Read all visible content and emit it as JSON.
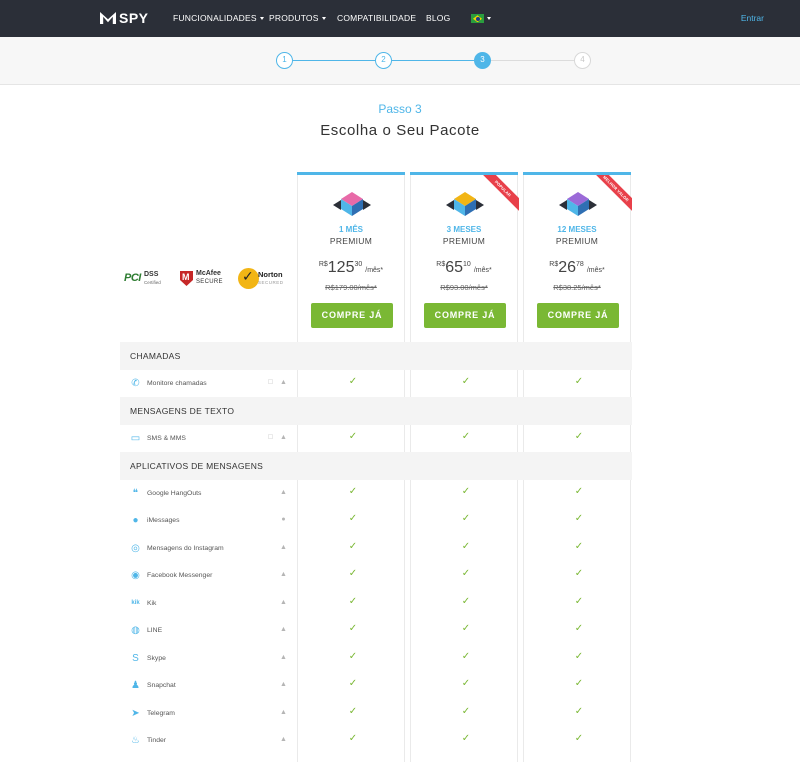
{
  "nav": {
    "logo_text": "SPY",
    "items": [
      "FUNCIONALIDADES",
      "PRODUTOS",
      "COMPATIBILIDADE",
      "BLOG"
    ],
    "login": "Entrar"
  },
  "steps": [
    "1",
    "2",
    "3",
    "4"
  ],
  "active_step": 3,
  "heading": {
    "step": "Passo 3",
    "title": "Escolha o Seu Pacote"
  },
  "badges": {
    "pci": "DSS",
    "pci_sub": "Certified",
    "mcafee": "McAfee",
    "mcafee_sub": "SECURE",
    "norton": "Norton",
    "norton_sub": "SECURED"
  },
  "plans": [
    {
      "months": "1 MÊS",
      "name": "PREMIUM",
      "currency": "R$",
      "int": "125",
      "cents": "30",
      "per": "/mês*",
      "old": "R$179.00/mês*",
      "button": "COMPRE JÁ",
      "ribbon": "",
      "colors": [
        "#e86aa8",
        "#4fb6e8"
      ]
    },
    {
      "months": "3 MESES",
      "name": "PREMIUM",
      "currency": "R$",
      "int": "65",
      "cents": "10",
      "per": "/mês*",
      "old": "R$93.00/mês*",
      "button": "COMPRE JÁ",
      "ribbon": "POPULAR",
      "colors": [
        "#f2b515",
        "#4fb6e8"
      ]
    },
    {
      "months": "12 MESES",
      "name": "PREMIUM",
      "currency": "R$",
      "int": "26",
      "cents": "78",
      "per": "/mês*",
      "old": "R$38.25/mês*",
      "button": "COMPRE JÁ",
      "ribbon": "MELHOR VALOR",
      "colors": [
        "#9b6ad8",
        "#4fb6e8"
      ]
    }
  ],
  "features": [
    {
      "type": "section",
      "label": "CHAMADAS"
    },
    {
      "type": "feature",
      "label": "Monitore chamadas",
      "icon": "phone-icon",
      "glyph": "✆",
      "os": [
        "apple",
        "android"
      ]
    },
    {
      "type": "section",
      "label": "MENSAGENS DE TEXTO"
    },
    {
      "type": "feature",
      "label": "SMS & MMS",
      "icon": "sms-icon",
      "glyph": "▭",
      "os": [
        "apple",
        "android"
      ]
    },
    {
      "type": "section",
      "label": "APLICATIVOS DE MENSAGENS"
    },
    {
      "type": "feature",
      "label": "Google HangOuts",
      "icon": "hangouts-icon",
      "glyph": "❝",
      "os": [
        "android"
      ]
    },
    {
      "type": "feature",
      "label": "iMessages",
      "icon": "imessage-icon",
      "glyph": "●",
      "os": [
        "apple"
      ]
    },
    {
      "type": "feature",
      "label": "Mensagens do Instagram",
      "icon": "instagram-icon",
      "glyph": "◎",
      "os": [
        "android"
      ]
    },
    {
      "type": "feature",
      "label": "Facebook Messenger",
      "icon": "messenger-icon",
      "glyph": "◉",
      "os": [
        "android"
      ]
    },
    {
      "type": "feature",
      "label": "Kik",
      "icon": "kik-icon",
      "glyph": "kik",
      "os": [
        "android"
      ]
    },
    {
      "type": "feature",
      "label": "LINE",
      "icon": "line-icon",
      "glyph": "◍",
      "os": [
        "android"
      ]
    },
    {
      "type": "feature",
      "label": "Skype",
      "icon": "skype-icon",
      "glyph": "S",
      "os": [
        "android"
      ]
    },
    {
      "type": "feature",
      "label": "Snapchat",
      "icon": "snapchat-icon",
      "glyph": "♟",
      "os": [
        "android"
      ]
    },
    {
      "type": "feature",
      "label": "Telegram",
      "icon": "telegram-icon",
      "glyph": "➤",
      "os": [
        "android"
      ]
    },
    {
      "type": "feature",
      "label": "Tinder",
      "icon": "tinder-icon",
      "glyph": "♨",
      "os": [
        "android"
      ]
    }
  ],
  "colors": {
    "accent": "#4fb6e8",
    "button": "#7ab834",
    "nav_bg": "#2b2f38",
    "ribbon": "#e8404a"
  }
}
